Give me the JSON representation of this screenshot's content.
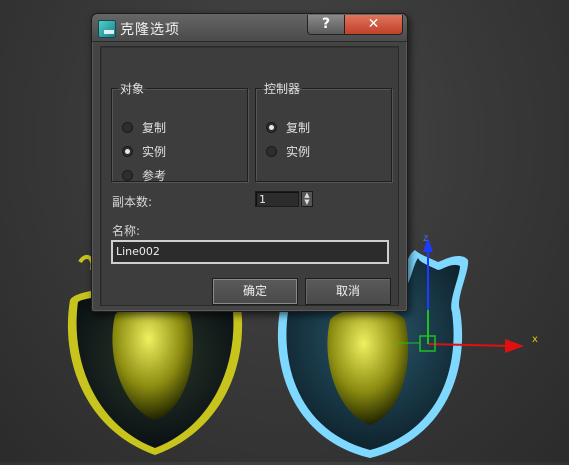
{
  "dialog": {
    "title": "克隆选项",
    "help_button": "?",
    "close_button": "✕",
    "object_group": {
      "legend": "对象",
      "options": [
        {
          "label": "复制",
          "selected": false
        },
        {
          "label": "实例",
          "selected": true
        },
        {
          "label": "参考",
          "selected": false
        }
      ]
    },
    "controller_group": {
      "legend": "控制器",
      "options": [
        {
          "label": "复制",
          "selected": true
        },
        {
          "label": "实例",
          "selected": false
        }
      ]
    },
    "copies_label": "副本数:",
    "copies_value": "1",
    "name_label": "名称:",
    "name_value": "Line002",
    "ok_label": "确定",
    "cancel_label": "取消"
  },
  "viewport": {
    "gizmo_x_label": "x",
    "gizmo_z_label": "z",
    "colors": {
      "selected_outline": "#7fd8ff",
      "x_axis": "#e01010",
      "y_axis": "#20c020",
      "z_axis": "#1c3cff",
      "pot_yellow": "#c8c41e",
      "pot_blue": "#2e6a8a"
    }
  }
}
